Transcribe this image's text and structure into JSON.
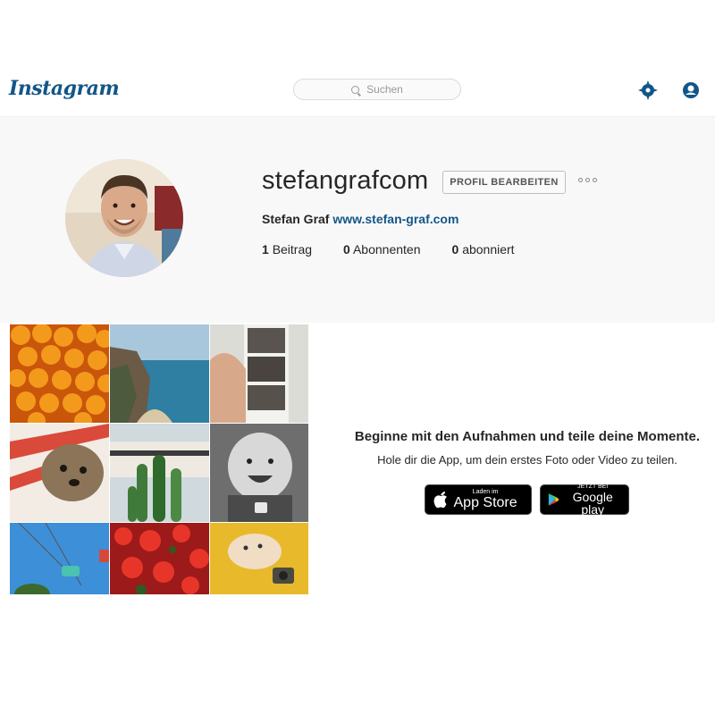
{
  "header": {
    "logo": "Instagram",
    "search_placeholder": "Suchen"
  },
  "profile": {
    "username": "stefangrafcom",
    "edit_button": "PROFIL BEARBEITEN",
    "full_name": "Stefan Graf",
    "website": "www.stefan-graf.com",
    "stats": [
      {
        "count": "1",
        "label": "Beitrag"
      },
      {
        "count": "0",
        "label": "Abonnenten"
      },
      {
        "count": "0",
        "label": "abonniert"
      }
    ]
  },
  "grid": {
    "tiles": [
      "oranges",
      "coastline",
      "photobooth-strip",
      "dog-on-pillow",
      "cactus-building",
      "laughing-baby",
      "ferris-wheel",
      "red-flowers",
      "cat-on-yellow"
    ]
  },
  "cta": {
    "title": "Beginne mit den Aufnahmen und teile deine Momente.",
    "subtitle": "Hole dir die App, um dein erstes Foto oder Video zu teilen.",
    "app_store_small": "Laden im",
    "app_store_big": "App Store",
    "google_play_small": "JETZT BEI",
    "google_play_big": "Google play"
  },
  "colors": {
    "brand": "#125688",
    "band": "#f8f8f8"
  }
}
